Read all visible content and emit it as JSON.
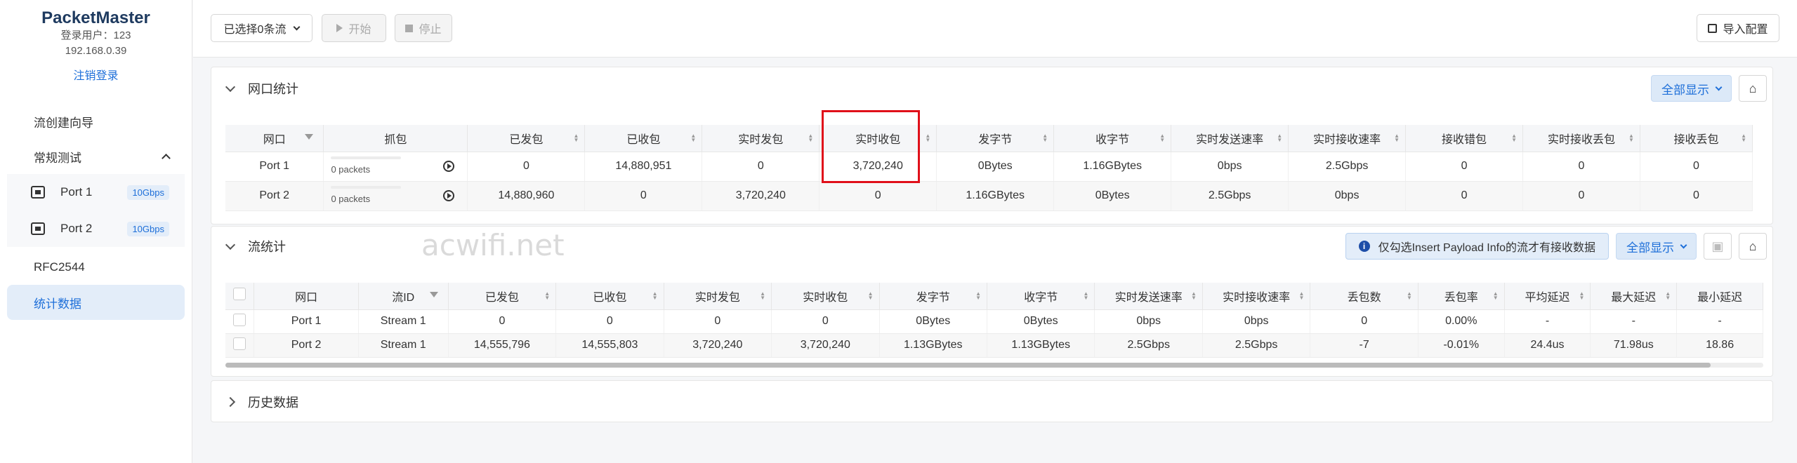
{
  "sidebar": {
    "app_name": "PacketMaster",
    "user_label": "登录用户：123",
    "ip": "192.168.0.39",
    "logout": "注销登录",
    "items": {
      "wizard": "流创建向导",
      "regular_test": "常规测试",
      "ports": [
        {
          "name": "Port 1",
          "badge": "10Gbps"
        },
        {
          "name": "Port 2",
          "badge": "10Gbps"
        }
      ],
      "rfc2544": "RFC2544",
      "stats": "统计数据"
    }
  },
  "topbar": {
    "selected_streams": "已选择0条流",
    "start": "开始",
    "stop": "停止",
    "import": "导入配置"
  },
  "port_stats": {
    "title": "网口统计",
    "display_all": "全部显示",
    "headers": [
      "网口",
      "抓包",
      "已发包",
      "已收包",
      "实时发包",
      "实时收包",
      "发字节",
      "收字节",
      "实时发送速率",
      "实时接收速率",
      "接收错包",
      "实时接收丢包",
      "接收丢包"
    ],
    "rows": [
      {
        "port": "Port 1",
        "packets": "0 packets",
        "sent": "0",
        "recv": "14,880,951",
        "rt_sent": "0",
        "rt_recv": "3,720,240",
        "tx_bytes": "0Bytes",
        "rx_bytes": "1.16GBytes",
        "tx_rate": "0bps",
        "rx_rate": "2.5Gbps",
        "rx_err": "0",
        "rt_drop": "0",
        "drop": "0"
      },
      {
        "port": "Port 2",
        "packets": "0 packets",
        "sent": "14,880,960",
        "recv": "0",
        "rt_sent": "3,720,240",
        "rt_recv": "0",
        "tx_bytes": "1.16GBytes",
        "rx_bytes": "0Bytes",
        "tx_rate": "2.5Gbps",
        "rx_rate": "0bps",
        "rx_err": "0",
        "rt_drop": "0",
        "drop": "0"
      }
    ]
  },
  "flow_stats": {
    "title": "流统计",
    "info": "仅勾选Insert Payload Info的流才有接收数据",
    "display_all": "全部显示",
    "headers": [
      "网口",
      "流ID",
      "已发包",
      "已收包",
      "实时发包",
      "实时收包",
      "发字节",
      "收字节",
      "实时发送速率",
      "实时接收速率",
      "丢包数",
      "丢包率",
      "平均延迟",
      "最大延迟",
      "最小延迟"
    ],
    "rows": [
      {
        "port": "Port 1",
        "id": "Stream 1",
        "sent": "0",
        "recv": "0",
        "rt_sent": "0",
        "rt_recv": "0",
        "tx_bytes": "0Bytes",
        "rx_bytes": "0Bytes",
        "tx_rate": "0bps",
        "rx_rate": "0bps",
        "lost": "0",
        "loss_rate": "0.00%",
        "avg": "-",
        "max": "-",
        "min": "-"
      },
      {
        "port": "Port 2",
        "id": "Stream 1",
        "sent": "14,555,796",
        "recv": "14,555,803",
        "rt_sent": "3,720,240",
        "rt_recv": "3,720,240",
        "tx_bytes": "1.13GBytes",
        "rx_bytes": "1.13GBytes",
        "tx_rate": "2.5Gbps",
        "rx_rate": "2.5Gbps",
        "lost": "-7",
        "loss_rate": "-0.01%",
        "avg": "24.4us",
        "max": "71.98us",
        "min": "18.86"
      }
    ]
  },
  "history": {
    "title": "历史数据"
  },
  "watermark": "acwifi.net"
}
